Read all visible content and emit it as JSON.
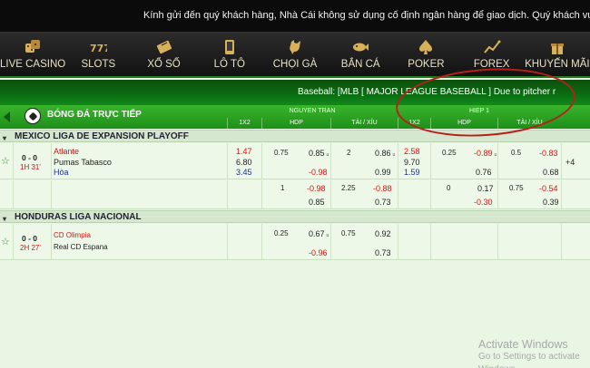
{
  "marquee": "Kính gửi đến quý khách hàng, Nhà Cái không sử dụng cố định ngân hàng để giao dịch. Quý khách vui lòng vào mục",
  "nav": [
    {
      "label": "LIVE CASINO",
      "icon": "dice-icon"
    },
    {
      "label": "SLOTS",
      "icon": "slot-777-icon"
    },
    {
      "label": "XỔ SỐ",
      "icon": "ticket-icon"
    },
    {
      "label": "LÔ TÔ",
      "icon": "phone-icon"
    },
    {
      "label": "CHỌI GÀ",
      "icon": "rooster-icon"
    },
    {
      "label": "BẮN CÁ",
      "icon": "fish-icon"
    },
    {
      "label": "POKER",
      "icon": "spade-icon"
    },
    {
      "label": "FOREX",
      "icon": "chart-icon"
    },
    {
      "label": "KHUYẾN MÃI",
      "icon": "gift-icon"
    }
  ],
  "ticker": "Baseball: [MLB [ MAJOR LEAGUE BASEBALL ] Due to pitcher r",
  "header": {
    "title": "BÓNG ĐÁ TRỰC TIẾP",
    "group_full": "NGUYEN TRAN",
    "group_half": "HIEP 1",
    "col_1x2": "1X2",
    "col_hdp": "HDP",
    "col_ou": "TÀI / XỈU",
    "col_1x2_half": "1X2",
    "col_hdp_half": "HDP",
    "col_ou_half": "TÀI / XỈU"
  },
  "leagues": [
    {
      "name": "MEXICO LIGA DE EXPANSION PLAYOFF",
      "match": {
        "score": "0 - 0",
        "time": "1H 31'",
        "home": "Atlante",
        "away": "Pumas Tabasco",
        "draw": "Hòa",
        "x12": [
          "1.47",
          "6.80",
          "3.45"
        ],
        "hdp_line": "0.75",
        "hdp_home": "0.85",
        "hdp_away": "-0.98",
        "ou_line": "2",
        "ou_over": "0.86",
        "ou_under": "0.99",
        "h1_x12": [
          "2.58",
          "9.70",
          "1.59"
        ],
        "h1_hdp_line": "0.25",
        "h1_hdp_home": "-0.89",
        "h1_hdp_away": "0.76",
        "h1_ou_line": "0.5",
        "h1_ou_over": "-0.83",
        "h1_ou_under": "0.68",
        "more": "+4",
        "u": "u"
      },
      "alt": {
        "hdp_line": "1",
        "hdp_home": "-0.98",
        "hdp_away": "0.85",
        "ou_line": "2.25",
        "ou_over": "-0.88",
        "ou_under": "0.73",
        "h1_hdp_line": "0",
        "h1_hdp_home": "0.17",
        "h1_hdp_away": "-0.30",
        "h1_ou_line": "0.75",
        "h1_ou_over": "-0.54",
        "h1_ou_under": "0.39"
      }
    },
    {
      "name": "HONDURAS LIGA NACIONAL",
      "match": {
        "score": "0 - 0",
        "time": "2H 27'",
        "home": "CD Olimpia",
        "away": "Real CD Espana",
        "hdp_line": "0.25",
        "hdp_home": "0.67",
        "hdp_away": "-0.96",
        "ou_line": "0.75",
        "ou_over": "0.92",
        "ou_under": "0.73"
      }
    }
  ],
  "watermark": {
    "line1": "Activate Windows",
    "line2": "Go to Settings to activate Windows."
  }
}
